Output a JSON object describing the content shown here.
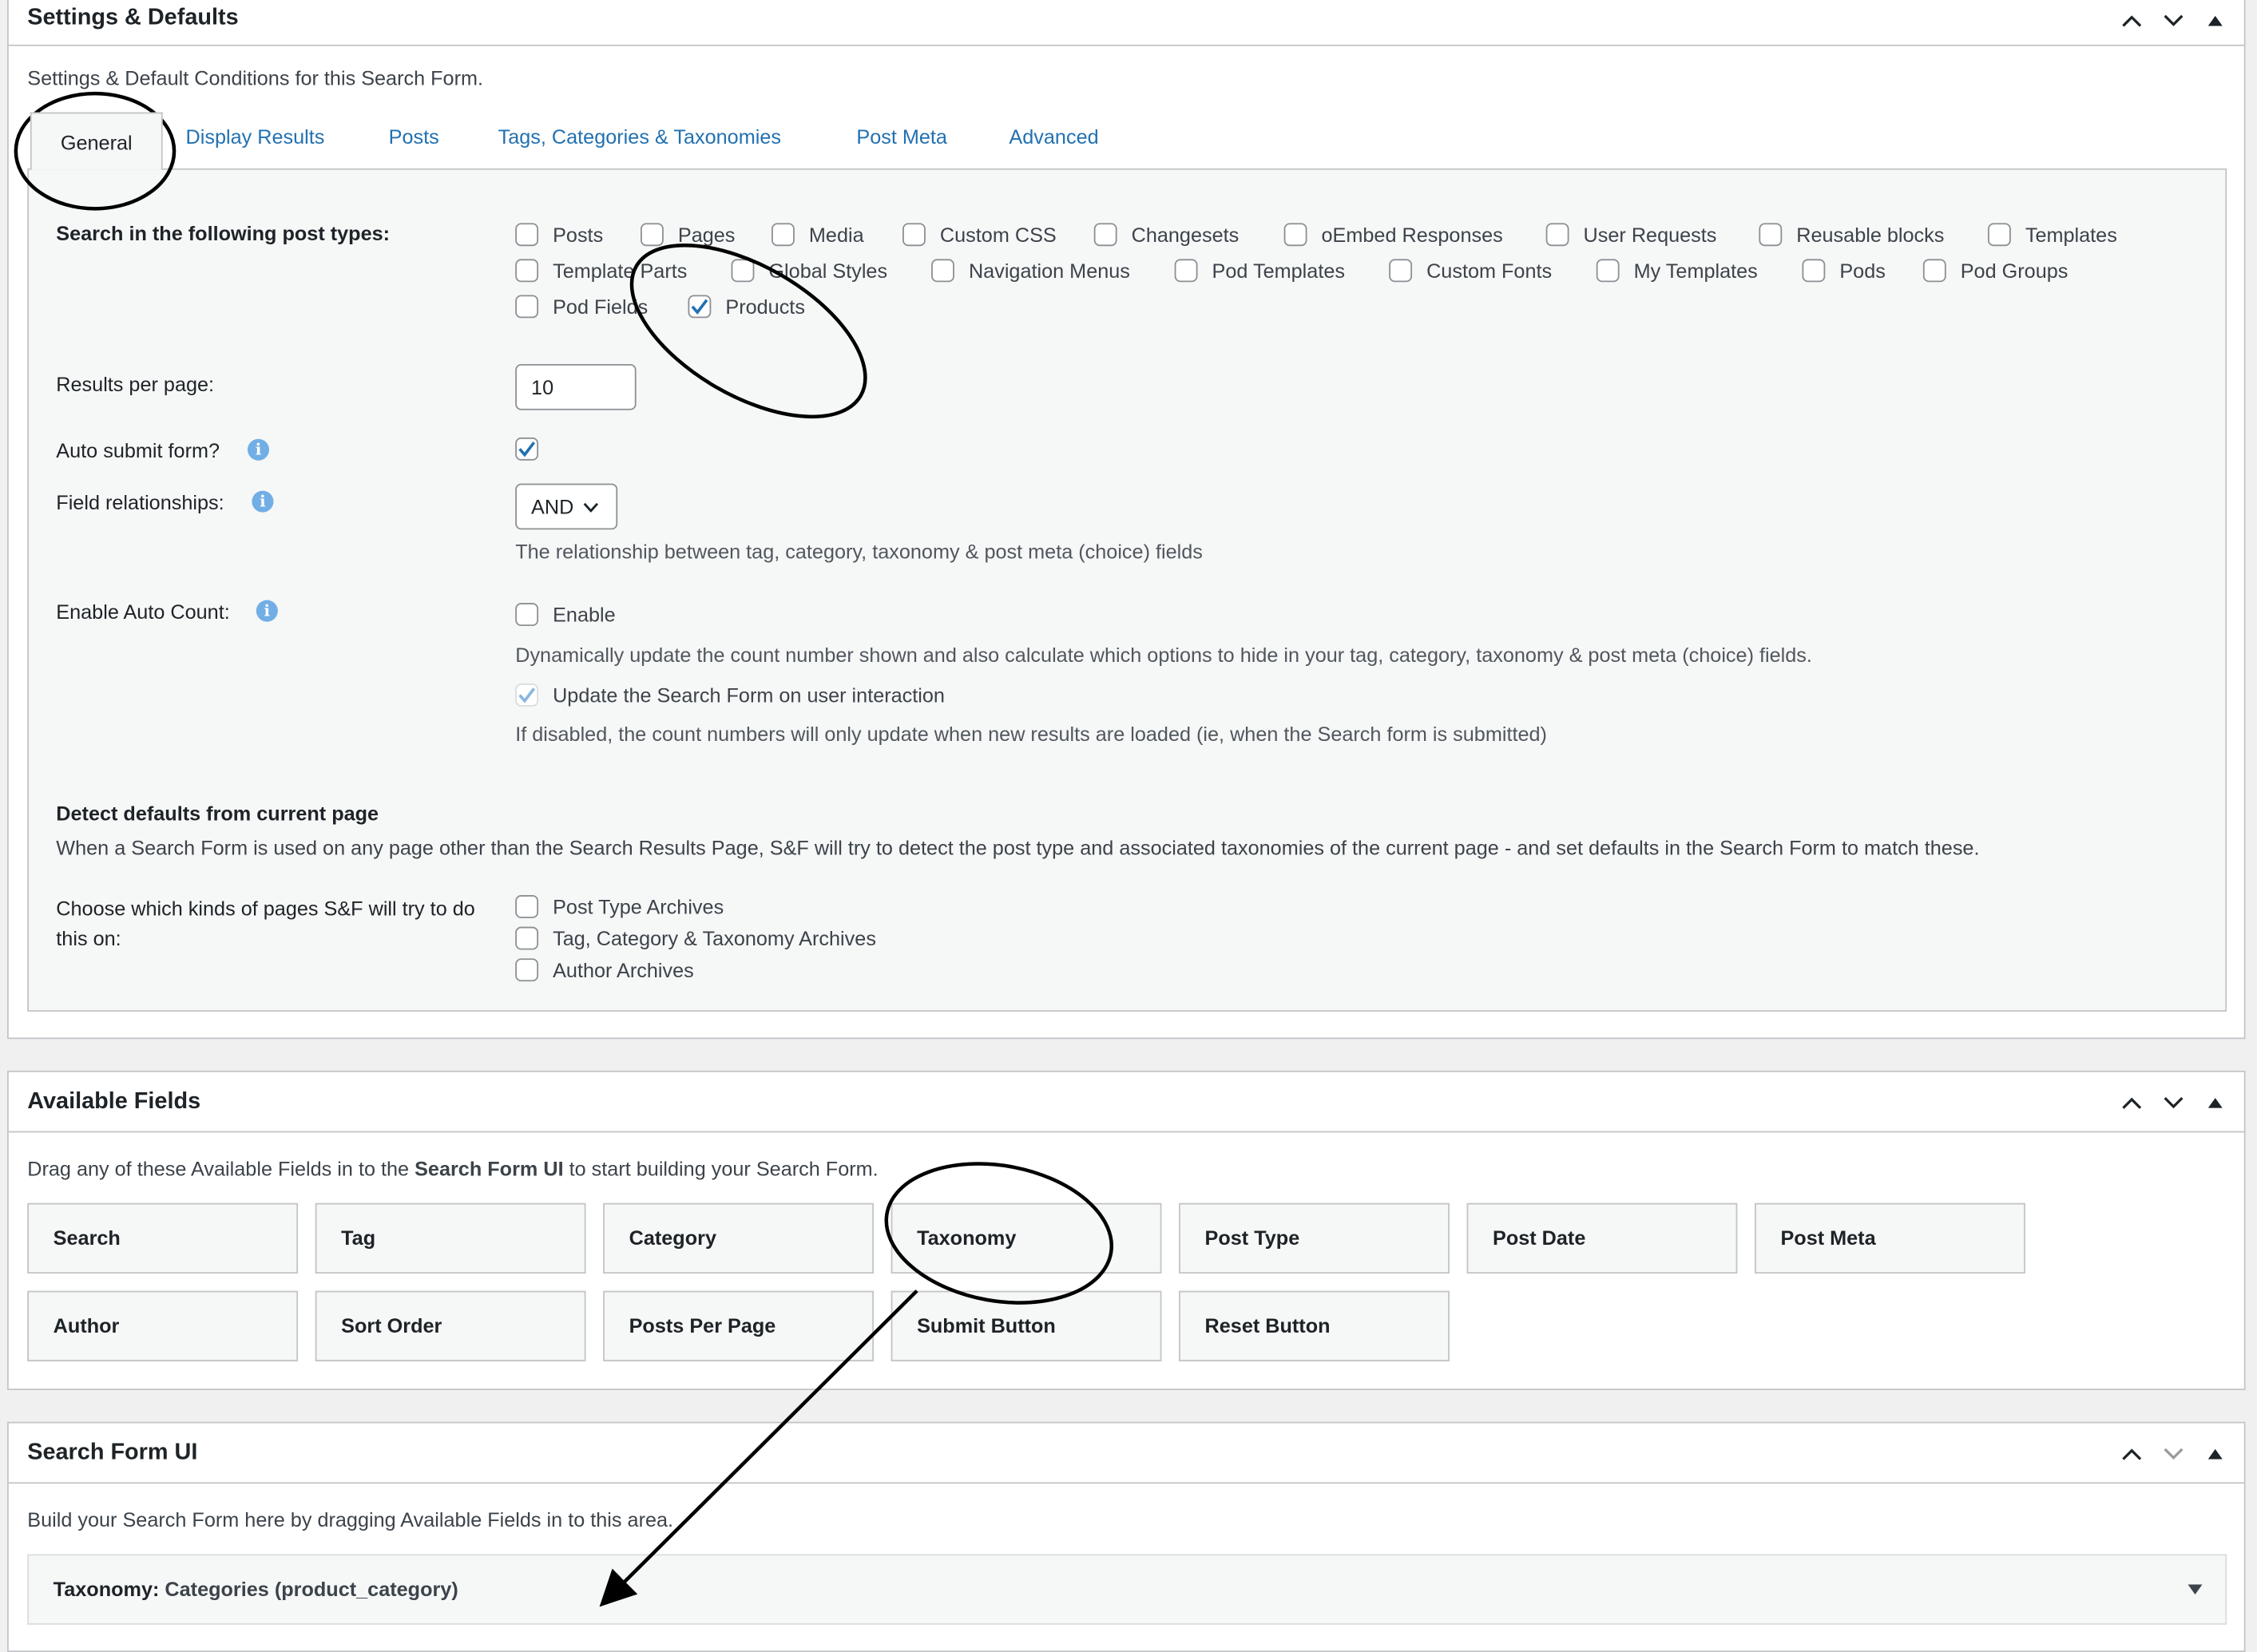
{
  "settings": {
    "title": "Settings & Defaults",
    "description": "Settings & Default Conditions for this Search Form.",
    "tabs": [
      "General",
      "Display Results",
      "Posts",
      "Tags, Categories & Taxonomies",
      "Post Meta",
      "Advanced"
    ],
    "active_tab": "General",
    "post_types_label": "Search in the following post types:",
    "post_types": [
      {
        "label": "Posts",
        "checked": false
      },
      {
        "label": "Pages",
        "checked": false
      },
      {
        "label": "Media",
        "checked": false
      },
      {
        "label": "Custom CSS",
        "checked": false
      },
      {
        "label": "Changesets",
        "checked": false
      },
      {
        "label": "oEmbed Responses",
        "checked": false
      },
      {
        "label": "User Requests",
        "checked": false
      },
      {
        "label": "Reusable blocks",
        "checked": false
      },
      {
        "label": "Templates",
        "checked": false
      },
      {
        "label": "Template Parts",
        "checked": false
      },
      {
        "label": "Global Styles",
        "checked": false
      },
      {
        "label": "Navigation Menus",
        "checked": false
      },
      {
        "label": "Pod Templates",
        "checked": false
      },
      {
        "label": "Custom Fonts",
        "checked": false
      },
      {
        "label": "My Templates",
        "checked": false
      },
      {
        "label": "Pods",
        "checked": false
      },
      {
        "label": "Pod Groups",
        "checked": false
      },
      {
        "label": "Pod Fields",
        "checked": false
      },
      {
        "label": "Products",
        "checked": true
      }
    ],
    "results_per_page_label": "Results per page:",
    "results_per_page_value": "10",
    "auto_submit_label": "Auto submit form?",
    "auto_submit_checked": true,
    "field_relationships_label": "Field relationships:",
    "field_relationships_value": "AND",
    "field_relationships_note": "The relationship between tag, category, taxonomy & post meta (choice) fields",
    "auto_count_label": "Enable Auto Count:",
    "auto_count_enable_label": "Enable",
    "auto_count_note": "Dynamically update the count number shown and also calculate which options to hide in your tag, category, taxonomy & post meta (choice) fields.",
    "update_form_label": "Update the Search Form on user interaction",
    "update_form_note": "If disabled, the count numbers will only update when new results are loaded (ie, when the Search form is submitted)",
    "detect_heading": "Detect defaults from current page",
    "detect_text": "When a Search Form is used on any page other than the Search Results Page, S&F will try to detect the post type and associated taxonomies of the current page - and set defaults in the Search Form to match these.",
    "choose_label": "Choose which kinds of pages S&F will try to do this on:",
    "page_kinds": [
      "Post Type Archives",
      "Tag, Category & Taxonomy Archives",
      "Author Archives"
    ]
  },
  "available_fields": {
    "title": "Available Fields",
    "desc_prefix": "Drag any of these Available Fields in to the",
    "desc_strong": "Search Form UI",
    "desc_suffix": "to start building your Search Form.",
    "fields": [
      "Search",
      "Tag",
      "Category",
      "Taxonomy",
      "Post Type",
      "Post Date",
      "Post Meta",
      "Author",
      "Sort Order",
      "Posts Per Page",
      "Submit Button",
      "Reset Button"
    ]
  },
  "search_form_ui": {
    "title": "Search Form UI",
    "description": "Build your Search Form here by dragging Available Fields in to this area.",
    "item_type": "Taxonomy:",
    "item_value": "Categories (product_category)"
  },
  "colors": {
    "link": "#2271b1",
    "checkbox_check": "#2271b1",
    "info_icon": "#72aee6"
  }
}
